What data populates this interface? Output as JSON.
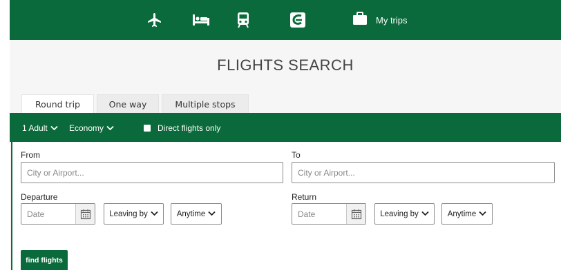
{
  "nav": {
    "icons": [
      "airplane-icon",
      "hotel-bed-icon",
      "train-icon",
      "car-rental-icon",
      "briefcase-icon"
    ],
    "my_trips_label": "My trips"
  },
  "page": {
    "title": "FLIGHTS SEARCH"
  },
  "tabs": [
    {
      "label": "Round trip",
      "active": true
    },
    {
      "label": "One way",
      "active": false
    },
    {
      "label": "Multiple stops",
      "active": false
    }
  ],
  "options": {
    "passengers": "1 Adult",
    "cabin": "Economy",
    "direct_label": "Direct flights only",
    "direct_checked": false
  },
  "form": {
    "from_label": "From",
    "from_placeholder": "City or Airport...",
    "to_label": "To",
    "to_placeholder": "City or Airport...",
    "departure_label": "Departure",
    "departure_placeholder": "Date",
    "departure_time": "Leaving by",
    "departure_window": "Anytime",
    "return_label": "Return",
    "return_placeholder": "Date",
    "return_time": "Leaving by",
    "return_window": "Anytime",
    "submit_label": "find flights"
  },
  "colors": {
    "brand_green": "#0a6a3b",
    "page_bg": "#f6f6f6",
    "tab_bg": "#ececec"
  }
}
